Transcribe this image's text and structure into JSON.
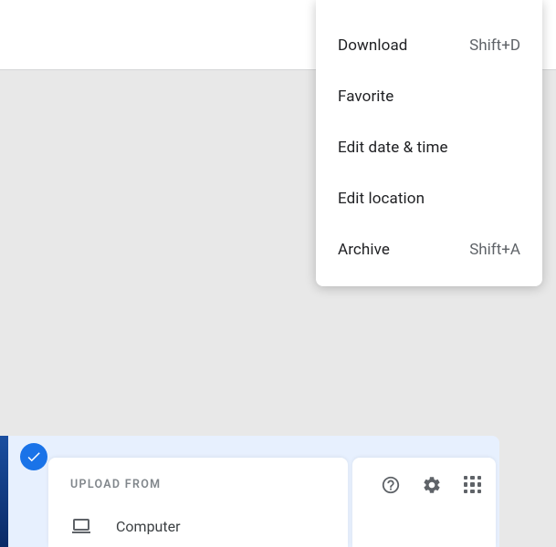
{
  "menu": {
    "items": [
      {
        "label": "Download",
        "shortcut": "Shift+D"
      },
      {
        "label": "Favorite",
        "shortcut": ""
      },
      {
        "label": "Edit date & time",
        "shortcut": ""
      },
      {
        "label": "Edit location",
        "shortcut": ""
      },
      {
        "label": "Archive",
        "shortcut": "Shift+A"
      }
    ]
  },
  "upload": {
    "heading": "Upload from",
    "option_computer": "Computer"
  }
}
